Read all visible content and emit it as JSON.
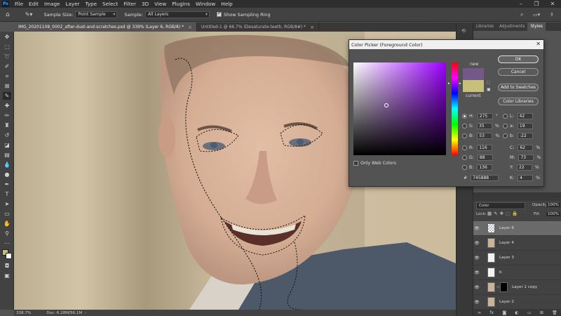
{
  "menubar": {
    "items": [
      "File",
      "Edit",
      "Image",
      "Layer",
      "Type",
      "Select",
      "Filter",
      "3D",
      "View",
      "Plugins",
      "Window",
      "Help"
    ]
  },
  "options": {
    "sample_size_label": "Sample Size:",
    "sample_size_value": "Point Sample",
    "sample_label": "Sample:",
    "sample_value": "All Layers",
    "sampling_ring_label": "Show Sampling Ring"
  },
  "tabs": [
    {
      "label": "IMG_20201108_0002_after-dust-and-scratches.psd @ 339% (Layer 6, RGB/8) *"
    },
    {
      "label": "Untitled-1 @ 66.7% (Desaturate-teeth, RGB/8#) *"
    }
  ],
  "status": {
    "zoom": "338.7%",
    "doc": "Doc: 6.28M/56.1M"
  },
  "dialog": {
    "title": "Color Picker (Foreground Color)",
    "ok": "OK",
    "cancel": "Cancel",
    "add_swatches": "Add to Swatches",
    "color_libraries": "Color Libraries",
    "new_label": "new",
    "current_label": "current",
    "new_color": "#745888",
    "current_color": "#c8bf7a",
    "only_web": "Only Web Colors",
    "hex_label": "#",
    "hex": "745888",
    "fields": {
      "H": {
        "label": "H:",
        "value": "275",
        "unit": "°"
      },
      "S": {
        "label": "S:",
        "value": "35",
        "unit": "%"
      },
      "B": {
        "label": "B:",
        "value": "53",
        "unit": "%"
      },
      "R": {
        "label": "R:",
        "value": "116"
      },
      "G": {
        "label": "G:",
        "value": "88"
      },
      "Bl": {
        "label": "B:",
        "value": "136"
      },
      "L": {
        "label": "L:",
        "value": "42"
      },
      "a": {
        "label": "a:",
        "value": "19"
      },
      "b": {
        "label": "b:",
        "value": "-22"
      },
      "C": {
        "label": "C:",
        "value": "62",
        "unit": "%"
      },
      "M": {
        "label": "M:",
        "value": "73",
        "unit": "%"
      },
      "Y": {
        "label": "Y:",
        "value": "22",
        "unit": "%"
      },
      "K": {
        "label": "K:",
        "value": "4",
        "unit": "%"
      }
    }
  },
  "right_panel": {
    "tabs": [
      "Libraries",
      "Adjustments",
      "Styles"
    ],
    "blend": "Color",
    "opacity_label": "Opacity:",
    "opacity": "100%",
    "lock_label": "Lock:",
    "fill_label": "Fill:",
    "fill": "100%",
    "layers": [
      "Layer 6",
      "Layer 4",
      "Layer 3",
      "b",
      "Layer 2 copy",
      "Layer 2"
    ]
  },
  "colors": {
    "fg": "#c8bf7a",
    "bg": "#ffffff",
    "accent": "#31a8ff"
  }
}
